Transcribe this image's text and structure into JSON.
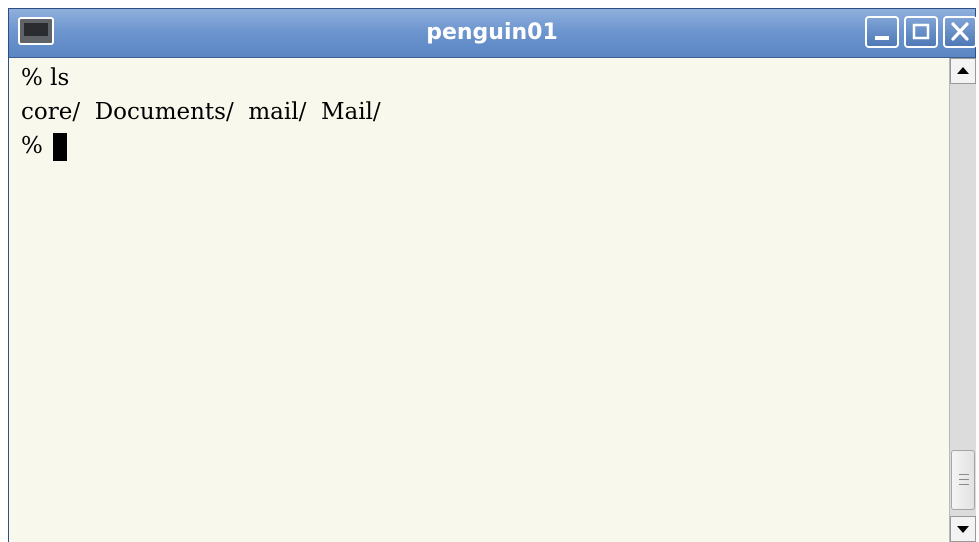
{
  "window": {
    "title": "penguin01",
    "menu_icon": "terminal-window-icon",
    "buttons": [
      "minimize-icon",
      "maximize-icon",
      "close-icon"
    ]
  },
  "terminal": {
    "lines": [
      "% ls",
      "core/  Documents/  mail/  Mail/",
      "% "
    ]
  },
  "scrollbar": {
    "up_icon": "arrow-up-icon",
    "down_icon": "arrow-down-icon",
    "thumb_position": 1.0
  },
  "colors": {
    "titlebar": "#6e96cf",
    "terminal_background": "#f8f8ec",
    "text": "#000000"
  }
}
